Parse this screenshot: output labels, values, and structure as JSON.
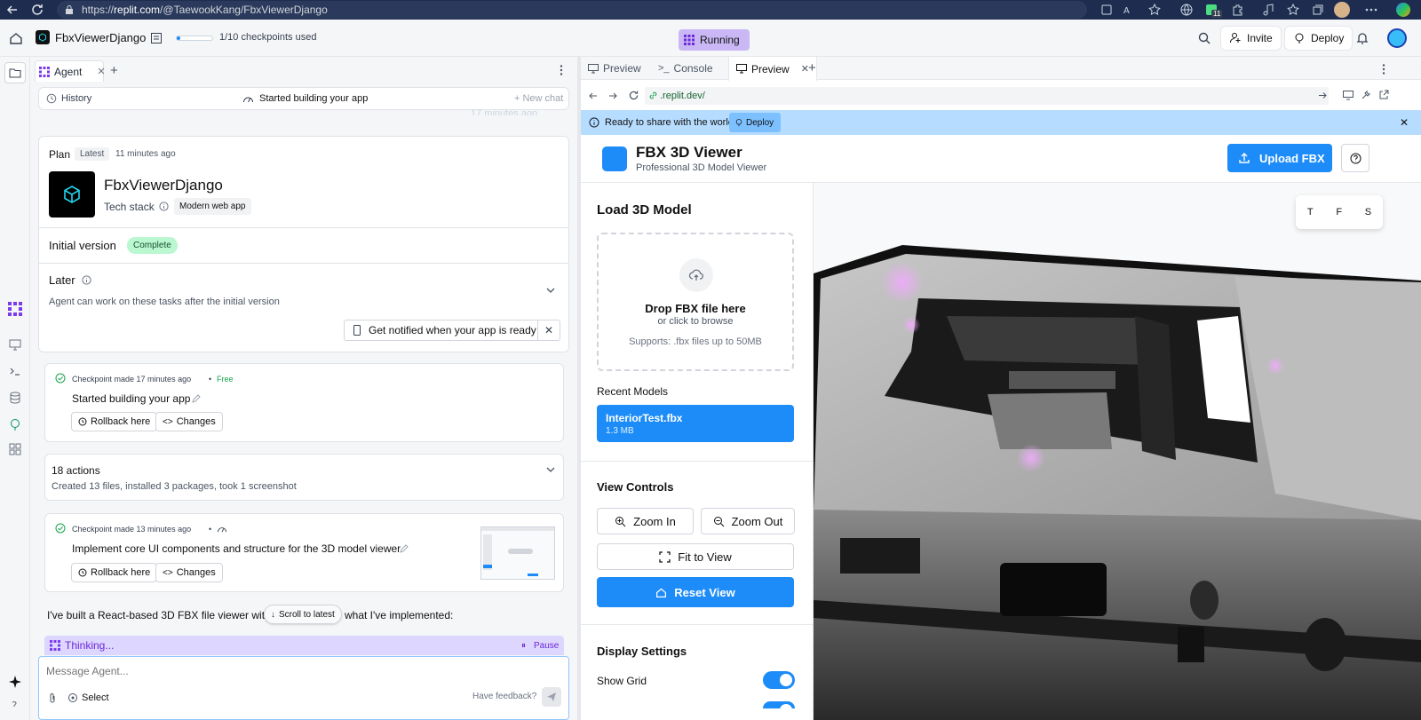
{
  "browser": {
    "url_prefix": "https://",
    "url_domain": "replit.com",
    "url_path": "/@TaewookKang/FbxViewerDjango",
    "ext_badge": "11"
  },
  "header": {
    "project_name": "FbxViewerDjango",
    "checkpoints": "1/10 checkpoints used",
    "checkpoint_progress": 0.1,
    "status": "Running",
    "invite": "Invite",
    "deploy": "Deploy"
  },
  "agent": {
    "tab": "Agent",
    "history": "History",
    "started": "Started building your app",
    "new_chat": "+ New chat",
    "faded_time": "17 minutes ago",
    "plan": {
      "label": "Plan",
      "badge": "Latest",
      "time": "11 minutes ago",
      "app_name": "FbxViewerDjango",
      "tech_stack": "Tech stack",
      "stack_value": "Modern web app"
    },
    "initial": {
      "title": "Initial version",
      "status": "Complete"
    },
    "later": {
      "title": "Later",
      "desc": "Agent can work on these tasks after the initial version",
      "notify": "Get notified when your app is ready"
    },
    "checkpoint1": {
      "meta": "Checkpoint made 17 minutes ago",
      "dot": "•",
      "free": "Free",
      "title": "Started building your app",
      "rollback": "Rollback here",
      "changes": "Changes"
    },
    "actions": {
      "title": "18 actions",
      "desc": "Created 13 files, installed 3 packages, took 1 screenshot"
    },
    "checkpoint2": {
      "meta": "Checkpoint made 13 minutes ago",
      "dot": "•",
      "title": "Implement core UI components and structure for the 3D model viewer",
      "rollback": "Rollback here",
      "changes": "Changes"
    },
    "message_start": "I've built a React-based 3D FBX file viewer with",
    "message_end": "what I've implemented:",
    "scroll_latest": "Scroll to latest",
    "thinking": "Thinking...",
    "pause": "Pause",
    "input_placeholder": "Message Agent...",
    "select": "Select",
    "feedback": "Have feedback?"
  },
  "panes": {
    "tab1": "Preview",
    "tab2": "Console",
    "tab3": "Preview"
  },
  "preview": {
    "address": ".replit.dev/",
    "banner": "Ready to share with the world?",
    "banner_button": "Deploy",
    "app_title": "FBX 3D Viewer",
    "app_subtitle": "Professional 3D Model Viewer",
    "upload": "Upload FBX",
    "load_title": "Load 3D Model",
    "drop_title": "Drop FBX file here",
    "drop_sub": "or click to browse",
    "supports": "Supports: .fbx files up to 50MB",
    "recent_title": "Recent Models",
    "recent_name": "InteriorTest.fbx",
    "recent_size": "1.3 MB",
    "view_title": "View Controls",
    "zoom_in": "Zoom In",
    "zoom_out": "Zoom Out",
    "fit": "Fit to View",
    "reset": "Reset View",
    "display_title": "Display Settings",
    "show_grid": "Show Grid",
    "view_t": "T",
    "view_f": "F",
    "view_s": "S"
  },
  "colors": {
    "accent": "#1d8cf8",
    "running_bg": "#c9b8f5",
    "complete_bg": "#bbf7d0",
    "thinking_bg": "#ddd6fe",
    "banner_bg": "#b6dcff"
  }
}
